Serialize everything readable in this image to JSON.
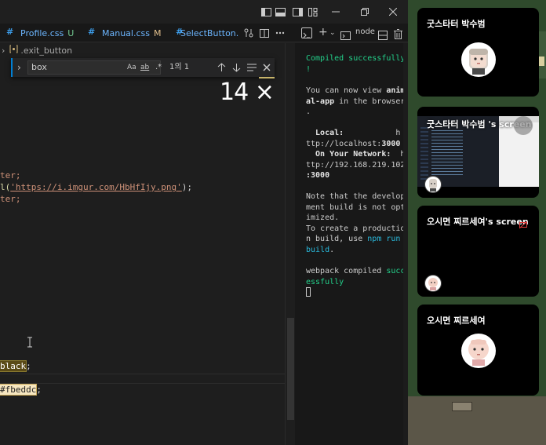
{
  "tabs": [
    {
      "label": "Profile.css",
      "status": "U"
    },
    {
      "label": "Manual.css",
      "status": "M"
    },
    {
      "label": "SelectButton.c",
      "status": ""
    }
  ],
  "breadcrumb": {
    "text": ".exit_button"
  },
  "find": {
    "query": "box",
    "opt_case": "Aa",
    "opt_word": "ab",
    "opt_regex": ".*",
    "count": "1의 1"
  },
  "zoom_overlay": "14 ×",
  "code": {
    "line1": "ter;",
    "line2_pre": "l(",
    "line2_str": "'https://i.imgur.com/HbHfIjy.png'",
    "line2_post": ");",
    "line3": "ter;",
    "black_word": "black",
    "black_tail": ";",
    "color_word": "#fbeddc",
    "color_tail": ";"
  },
  "terminal": {
    "header_label": "node",
    "lines": {
      "l1": "Compiled successfully",
      "l2": "!",
      "l3a": "You can now view ",
      "l3b": "anim",
      "l4a": "al-app",
      "l4b": " in the browser",
      "l5": ".",
      "l6a": "  Local:",
      "l6b": "           h",
      "l7a": "ttp://localhost:",
      "l7b": "3000",
      "l8a": "  On Your Network:",
      "l8b": "  h",
      "l9": "ttp://192.168.219.102",
      "l10": ":3000",
      "l11": "Note that the develop",
      "l12": "ment build is not opt",
      "l13": "imized.",
      "l14": "To create a productio",
      "l15a": "n build, use ",
      "l15b": "npm run",
      "l16": "build",
      "l16b": ".",
      "l17a": "webpack compiled ",
      "l17b": "succ",
      "l18": "essfully"
    }
  },
  "participants": [
    {
      "name": "굿스타터 박수범"
    },
    {
      "name": "굿스타터 박수범 's screen"
    },
    {
      "name": "오시면 찌르세여's screen"
    },
    {
      "name": "오시면 찌르세여"
    }
  ],
  "colors": {
    "accent_blue": "#3c9ce8",
    "terminal_green": "#23d18b",
    "terminal_cyan": "#29b8db",
    "string_orange": "#ce9178",
    "find_highlight": "#f6e6c0"
  }
}
